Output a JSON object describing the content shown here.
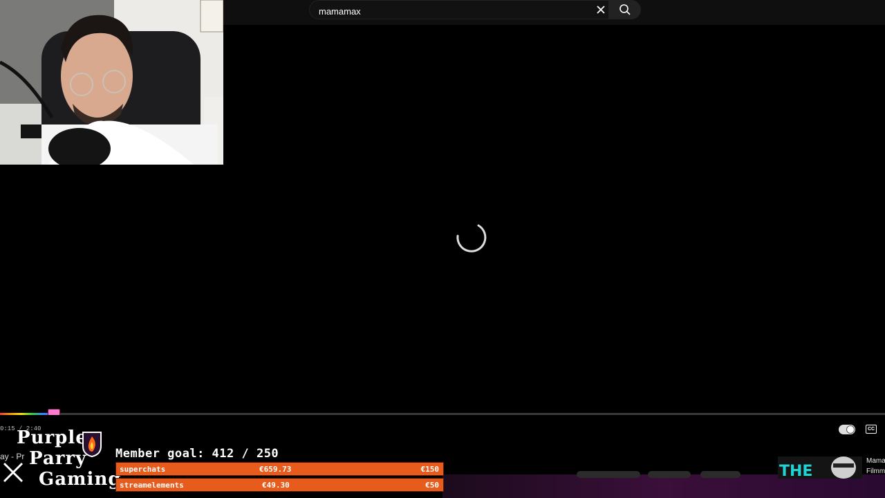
{
  "search": {
    "value": "mamamax",
    "clear_icon": "close-icon",
    "search_icon": "search-icon"
  },
  "player": {
    "time_text": "0:15 / 2:40",
    "progress": 0.06,
    "autoplay_icon": "autoplay-toggle-icon",
    "cc_label": "CC"
  },
  "overlay": {
    "logo": [
      "Purple",
      "Parry",
      "Gaming"
    ],
    "side_label": "ay - Pr",
    "member_goal": "Member goal: 412 / 250",
    "bars": [
      {
        "label": "superchats",
        "amount": "€659.73",
        "target": "€150"
      },
      {
        "label": "streamelements",
        "amount": "€49.30",
        "target": "€50"
      }
    ]
  },
  "sidebar_video": {
    "title_line1": "Mama",
    "title_line2": "Filmm"
  },
  "colors": {
    "accent_orange": "#e75c1c",
    "background": "#000000"
  }
}
